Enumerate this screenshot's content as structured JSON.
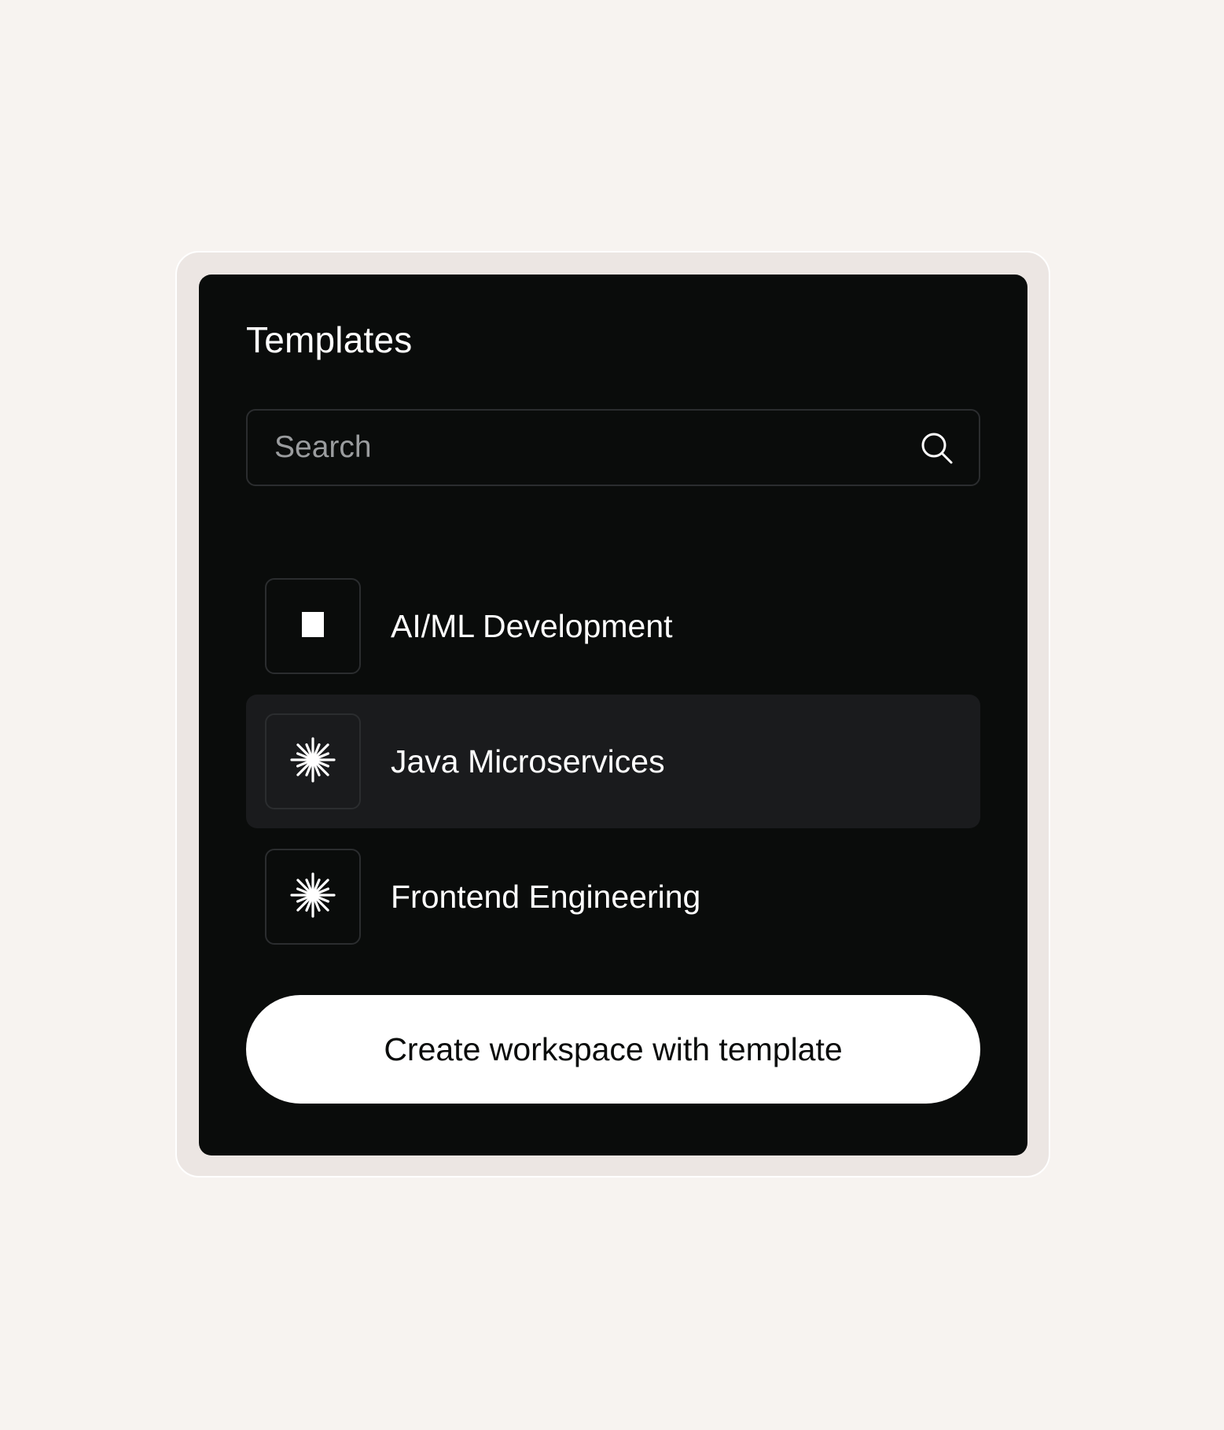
{
  "panel": {
    "title": "Templates"
  },
  "search": {
    "placeholder": "Search",
    "value": ""
  },
  "templates": {
    "items": [
      {
        "label": "AI/ML Development",
        "icon": "square-icon",
        "selected": false
      },
      {
        "label": "Java Microservices",
        "icon": "asterisk-icon",
        "selected": true
      },
      {
        "label": "Frontend Engineering",
        "icon": "asterisk-icon",
        "selected": false
      }
    ]
  },
  "actions": {
    "create_label": "Create workspace with template"
  },
  "colors": {
    "page_background": "#f7f3f0",
    "panel_background": "#0a0c0b",
    "selected_row": "#1a1b1d",
    "border": "#2b2d2f",
    "button_background": "#ffffff"
  }
}
